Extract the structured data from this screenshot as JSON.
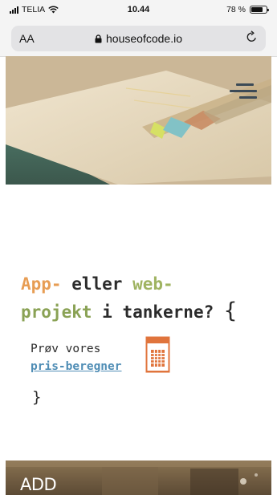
{
  "status_bar": {
    "carrier": "TELIA",
    "time": "10.44",
    "battery": "78 %",
    "battery_level": 0.78
  },
  "browser": {
    "text_size_label": "AA",
    "host": "houseofcode.io",
    "icons": [
      "lock-icon",
      "reload-icon"
    ]
  },
  "hero": {
    "menu_icon": "hamburger-menu-icon"
  },
  "headline": {
    "app": "App-",
    "eller": " eller ",
    "web": "web-",
    "projekt": "projekt",
    "rest": " i tankerne?",
    "brace": "{"
  },
  "cta": {
    "prefix": "Prøv vores",
    "link": "pris-beregner",
    "icon": "calculator-icon",
    "closing_brace": "}"
  },
  "footer": {
    "logo_text": "ADD"
  },
  "colors": {
    "app": "#e79d54",
    "web": "#9fb361",
    "link": "#4f8db5",
    "calculator": "#e0743c"
  }
}
